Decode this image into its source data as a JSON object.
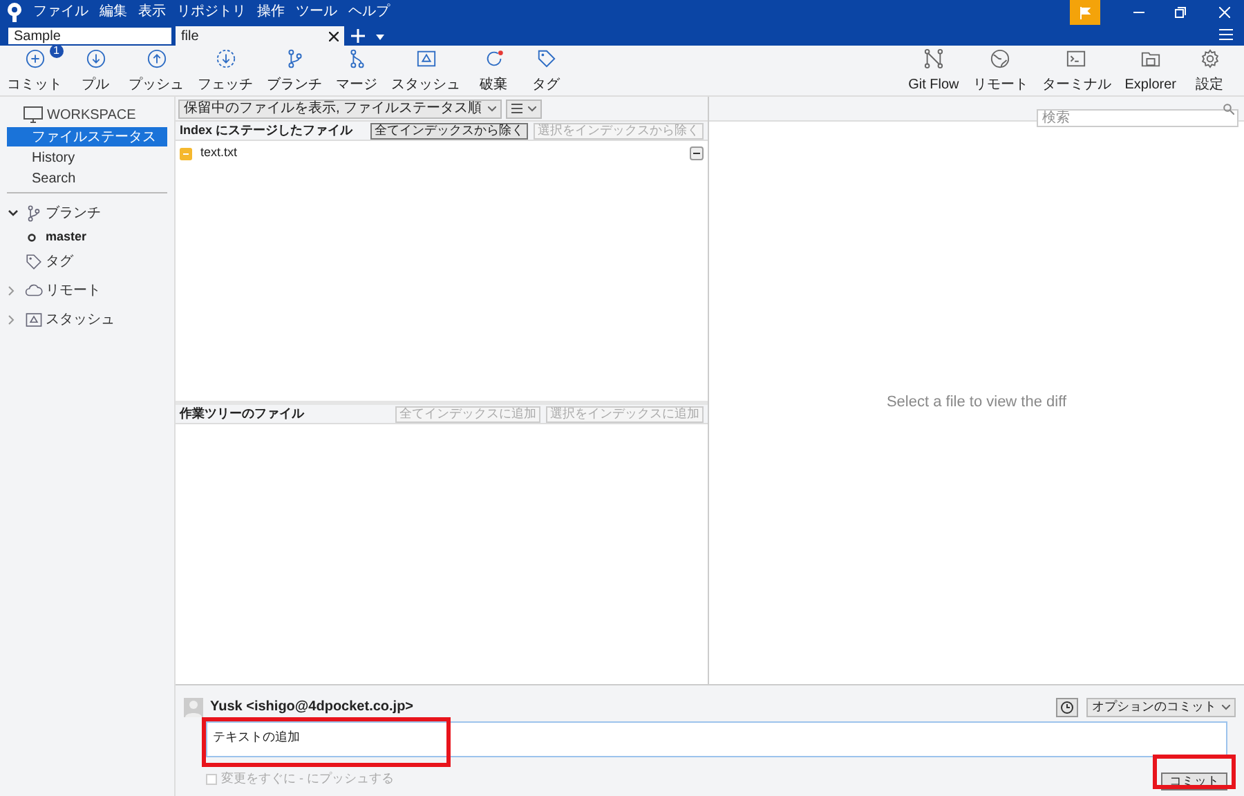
{
  "menu": [
    "ファイル",
    "編集",
    "表示",
    "リポジトリ",
    "操作",
    "ツール",
    "ヘルプ"
  ],
  "window_tabs": [
    {
      "label": "Sample",
      "selected": false
    },
    {
      "label": "file",
      "selected": true
    }
  ],
  "toolbar": {
    "left": [
      {
        "label": "コミット",
        "kind": "commit",
        "badge": "1"
      },
      {
        "label": "プル",
        "kind": "pull"
      },
      {
        "label": "プッシュ",
        "kind": "push"
      },
      {
        "label": "フェッチ",
        "kind": "fetch"
      },
      {
        "label": "ブランチ",
        "kind": "branch"
      },
      {
        "label": "マージ",
        "kind": "merge"
      },
      {
        "label": "スタッシュ",
        "kind": "stash"
      },
      {
        "label": "破棄",
        "kind": "discard"
      },
      {
        "label": "タグ",
        "kind": "tag"
      }
    ],
    "right": [
      {
        "label": "Git Flow",
        "kind": "gitflow"
      },
      {
        "label": "リモート",
        "kind": "globe"
      },
      {
        "label": "ターミナル",
        "kind": "terminal"
      },
      {
        "label": "Explorer",
        "kind": "folder"
      },
      {
        "label": "設定",
        "kind": "gear"
      }
    ]
  },
  "sidebar": {
    "workspace": {
      "label": "WORKSPACE",
      "items": [
        {
          "label": "ファイルステータス",
          "selected": true
        },
        {
          "label": "History",
          "selected": false
        },
        {
          "label": "Search",
          "selected": false
        }
      ]
    },
    "sections": [
      {
        "label": "ブランチ",
        "kind": "branch",
        "expanded": true,
        "children": [
          {
            "label": "master"
          }
        ]
      },
      {
        "label": "タグ",
        "kind": "tag"
      },
      {
        "label": "リモート",
        "kind": "cloud",
        "expanded": false
      },
      {
        "label": "スタッシュ",
        "kind": "stash",
        "expanded": false
      }
    ]
  },
  "filter": {
    "value": "保留中のファイルを表示, ファイルステータス順"
  },
  "search": {
    "placeholder": "検索"
  },
  "staged": {
    "title": "Index にステージしたファイル",
    "buttons": [
      {
        "label": "全てインデックスから除く",
        "disabled": false
      },
      {
        "label": "選択をインデックスから除く",
        "disabled": true
      }
    ],
    "files": [
      {
        "name": "text.txt"
      }
    ]
  },
  "unstaged": {
    "title": "作業ツリーのファイル",
    "buttons": [
      {
        "label": "全てインデックスに追加",
        "disabled": true
      },
      {
        "label": "選択をインデックスに追加",
        "disabled": true
      }
    ]
  },
  "diff": {
    "message": "Select a file to view the diff"
  },
  "commit": {
    "author": "Yusk <ishigo@4dpocket.co.jp>",
    "options": "オプションのコミット",
    "message": {
      "value": "テキストの追加",
      "highlighted": true
    },
    "push_option": {
      "label": "変更をすぐに - にプッシュする",
      "checked": false,
      "disabled": true
    },
    "button": {
      "label": "コミット",
      "highlighted": true
    }
  }
}
